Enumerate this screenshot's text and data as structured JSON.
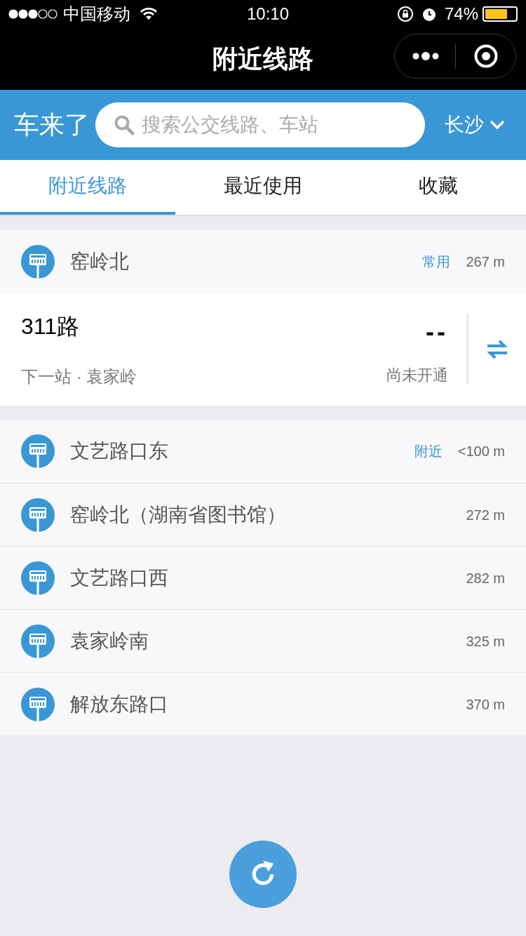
{
  "status_bar": {
    "carrier": "中国移动",
    "time": "10:10",
    "battery": "74%"
  },
  "nav": {
    "title": "附近线路"
  },
  "header": {
    "brand": "车来了",
    "search": {
      "placeholder": "搜索公交线路、车站"
    },
    "city": "长沙"
  },
  "tabs": [
    {
      "label": "附近线路",
      "selected": true
    },
    {
      "label": "最近使用",
      "selected": false
    },
    {
      "label": "收藏",
      "selected": false
    }
  ],
  "nearest_station": {
    "name": "窑岭北",
    "tag": "常用",
    "distance": "267 m",
    "routes": [
      {
        "name": "311路",
        "next_stop": "下一站 · 袁家岭",
        "arrival": "--",
        "status": "尚未开通"
      }
    ]
  },
  "stations": [
    {
      "name": "文艺路口东",
      "tag": "附近",
      "distance": "<100 m"
    },
    {
      "name": "窑岭北（湖南省图书馆）",
      "distance": "272 m"
    },
    {
      "name": "文艺路口西",
      "distance": "282 m"
    },
    {
      "name": "袁家岭南",
      "distance": "325 m"
    },
    {
      "name": "解放东路口",
      "distance": "370 m"
    }
  ]
}
